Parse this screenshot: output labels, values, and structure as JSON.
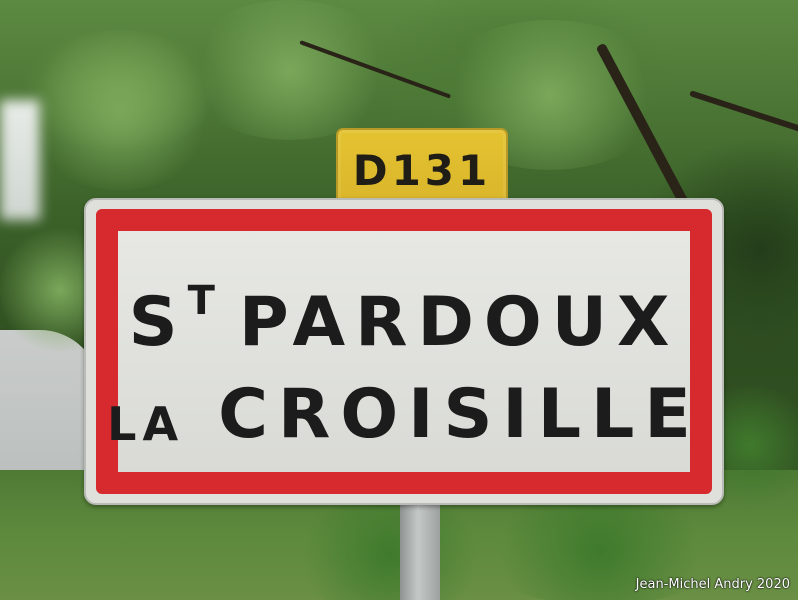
{
  "road_marker": {
    "text": "D131"
  },
  "town_sign": {
    "line1_prefix": "S",
    "line1_prefix_sup": "T",
    "line1_name": "PARDOUX",
    "line2_article": "LA",
    "line2_name": "CROISILLE",
    "colors": {
      "border": "#d62a2e",
      "background": "#e2e3df",
      "text": "#1c1c1c"
    }
  },
  "photo_credit": "Jean-Michel Andry 2020"
}
